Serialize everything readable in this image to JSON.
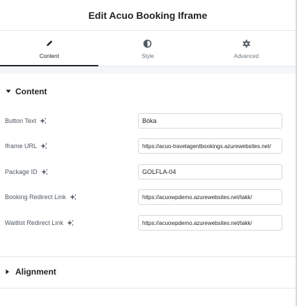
{
  "header": {
    "title": "Edit Acuo Booking Iframe"
  },
  "tabs": [
    {
      "label": "Content",
      "icon": "pencil-icon",
      "active": true
    },
    {
      "label": "Style",
      "icon": "contrast-icon",
      "active": false
    },
    {
      "label": "Advanced",
      "icon": "gear-icon",
      "active": false
    }
  ],
  "content_section": {
    "title": "Content",
    "expanded": true,
    "fields": [
      {
        "label": "Button Text",
        "value": "Bóka"
      },
      {
        "label": "Iframe URL",
        "value": "https://acuo-travelagentbookings.azurewebsites.net/"
      },
      {
        "label": "Package ID",
        "value": "GOLFLA-04"
      },
      {
        "label": "Booking Redirect Link",
        "value": "https://acuowpdemo.azurewebsites.net/takk/"
      },
      {
        "label": "Waitlist Redirect Link",
        "value": "https://acuowpdemo.azurewebsites.net/takk/"
      }
    ]
  },
  "alignment_section": {
    "title": "Alignment",
    "expanded": false
  },
  "colors": {
    "accent": "#1f2124",
    "text": "#515962",
    "border": "#d5d8dc"
  }
}
